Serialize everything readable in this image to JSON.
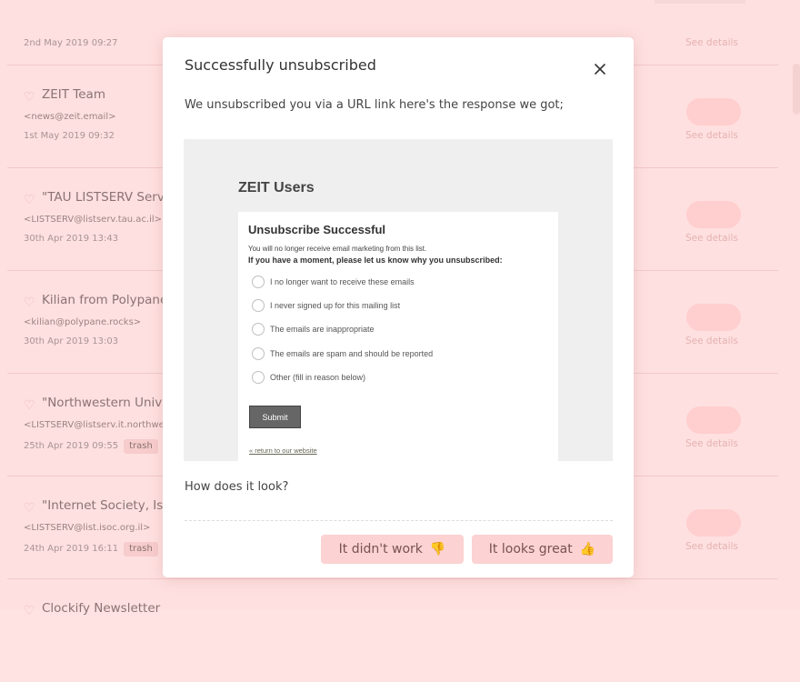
{
  "background_list": {
    "rows": [
      {
        "sender": "",
        "address": "",
        "date": "2nd May 2019 09:27",
        "tag": "",
        "see_details": "See details"
      },
      {
        "sender": "ZEIT Team",
        "address": "<news@zeit.email>",
        "date": "1st May 2019 09:32",
        "tag": "",
        "see_details": "See details"
      },
      {
        "sender": "\"TAU LISTSERV Serv",
        "address": "<LISTSERV@listserv.tau.ac.il>",
        "date": "30th Apr 2019 13:43",
        "tag": "",
        "see_details": "See details"
      },
      {
        "sender": "Kilian from Polypane",
        "address": "<kilian@polypane.rocks>",
        "date": "30th Apr 2019 13:03",
        "tag": "",
        "see_details": "See details"
      },
      {
        "sender": "\"Northwestern Unive",
        "address": "<LISTSERV@listserv.it.northwe",
        "date": "25th Apr 2019 09:55",
        "tag": "trash",
        "see_details": "See details"
      },
      {
        "sender": "\"Internet Society, Isra",
        "address": "<LISTSERV@list.isoc.org.il>",
        "date": "24th Apr 2019 16:11",
        "tag": "trash",
        "see_details": "See details"
      },
      {
        "sender": "Clockify Newsletter",
        "address": "",
        "date": "",
        "tag": "",
        "see_details": ""
      }
    ]
  },
  "modal": {
    "title": "Successfully unsubscribed",
    "intro": "We unsubscribed you via a URL link here's the response we got;",
    "question": "How does it look?",
    "buttons": {
      "bad_label": "It didn't work",
      "bad_emoji": "👎",
      "good_label": "It looks great",
      "good_emoji": "👍"
    }
  },
  "preview": {
    "list_name": "ZEIT Users",
    "card_title": "Unsubscribe Successful",
    "line": "You will no longer receive email marketing from this list.",
    "ask": "If you have a moment, please let us know why you unsubscribed:",
    "options": [
      "I no longer want to receive these emails",
      "I never signed up for this mailing list",
      "The emails are inappropriate",
      "The emails are spam and should be reported",
      "Other (fill in reason below)"
    ],
    "submit": "Submit",
    "return_link": "« return to our website"
  }
}
